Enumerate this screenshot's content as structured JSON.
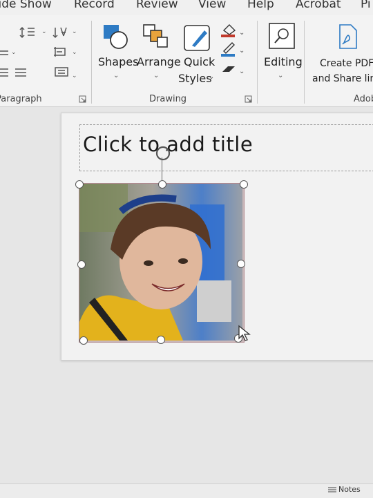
{
  "tabs": [
    "Slide Show",
    "Record",
    "Review",
    "View",
    "Help",
    "Acrobat",
    "Pi"
  ],
  "ribbon": {
    "paragraph_group": "Paragraph",
    "drawing_group": "Drawing",
    "adobe_group": "Adob",
    "shapes_label": "Shapes",
    "arrange_label": "Arrange",
    "quick_styles_line1": "Quick",
    "quick_styles_line2": "Styles",
    "editing_label": "Editing",
    "create_pdf_line1": "Create PDF",
    "create_pdf_line2": "and Share link"
  },
  "slide": {
    "title_placeholder": "Click to add title"
  },
  "status": {
    "notes_label": "Notes"
  },
  "colors": {
    "accent_red": "#c0392b",
    "accent_blue": "#2e7bc4",
    "frame_border": "#b08a90"
  }
}
